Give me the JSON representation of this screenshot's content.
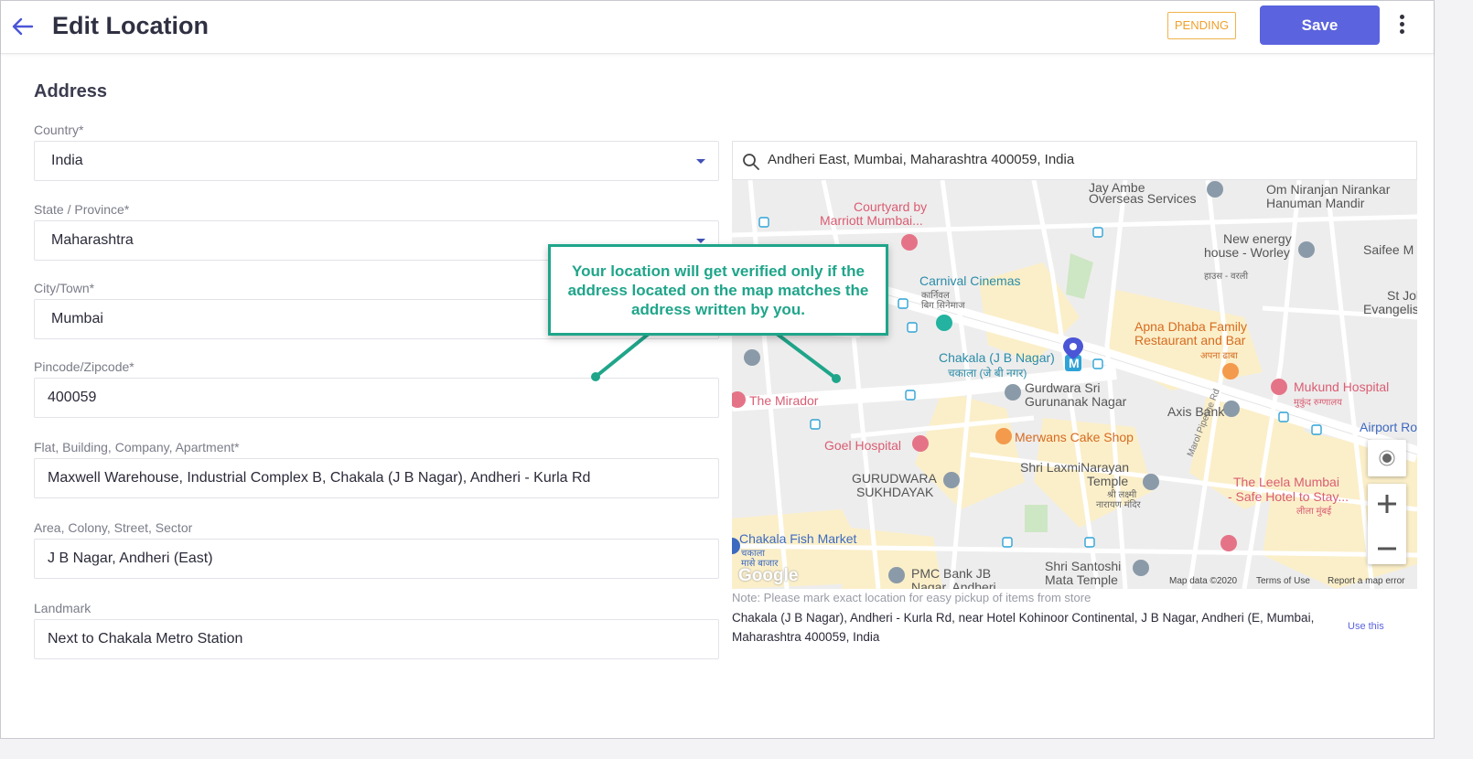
{
  "header": {
    "title": "Edit Location",
    "status": "PENDING",
    "save_label": "Save"
  },
  "form": {
    "section_title": "Address",
    "country": {
      "label": "Country*",
      "value": "India"
    },
    "state": {
      "label": "State / Province*",
      "value": "Maharashtra"
    },
    "city": {
      "label": "City/Town*",
      "value": "Mumbai"
    },
    "pincode": {
      "label": "Pincode/Zipcode*",
      "value": "400059"
    },
    "flat": {
      "label": "Flat, Building, Company, Apartment*",
      "value": "Maxwell Warehouse, Industrial Complex B, Chakala (J B Nagar), Andheri - Kurla Rd"
    },
    "area": {
      "label": "Area, Colony, Street, Sector",
      "value": "J B Nagar, Andheri (East)"
    },
    "landmark": {
      "label": "Landmark",
      "value": "Next to Chakala Metro Station"
    }
  },
  "map": {
    "search_value": "Andheri East, Mumbai, Maharashtra 400059, India",
    "labels": {
      "jay_ambe": "Jay Ambe",
      "overseas": "Overseas Services",
      "om_niranjan": "Om Niranjan Nirankar",
      "hanuman": "Hanuman Mandir",
      "courtyard": "Courtyard by",
      "marriott": "Marriott Mumbai...",
      "new_energy": "New energy",
      "worley": "house - Worley",
      "worley_hi": "हाउस - वरली",
      "saifee": "Saifee M",
      "carnival": "Carnival Cinemas",
      "carnival_mr": "कार्निवल",
      "carnival_hi": "बिग सिनेमाज",
      "st_john": "St Johi",
      "evangelist": "Evangelist Ch",
      "apna_dhaba": "Apna Dhaba Family",
      "restaurant_bar": "Restaurant and Bar",
      "apna_hi": "अपना ढाबा",
      "chakala": "Chakala (J B Nagar)",
      "chakala_mr": "चकाला (जे बी नगर)",
      "mirador": "The Mirador",
      "gurdwara": "Gurdwara Sri",
      "gurunanak": "Gurunanak Nagar",
      "axis": "Axis Bank",
      "mukund": "Mukund Hospital",
      "mukund_mr": "मुकुंद रुग्णालय",
      "goel": "Goel Hospital",
      "merwans": "Merwans Cake Shop",
      "airport": "Airport Ro",
      "laxmi": "Shri LaxmiNarayan",
      "temple": "Temple",
      "laxmi_hi": "श्री लक्ष्मी",
      "narayan_hi": "नारायण मंदिर",
      "gurudwara": "GURUDWARA",
      "sukhdayak": "SUKHDAYAK",
      "leela": "The Leela Mumbai",
      "leela2": "- Safe Hotel to Stay...",
      "leela_hi": "लीला मुंबई",
      "marol": "Marol Pipeline Rd",
      "chakala_fish": "Chakala Fish Market",
      "chakala_fish_mr": "चकाला",
      "fish_mr": "मासे बाजार",
      "pmc": "PMC Bank JB",
      "pmc2": "Nagar, Andheri",
      "santoshi": "Shri Santoshi",
      "mata": "Mata Temple",
      "google": "Google",
      "map_data": "Map data ©2020",
      "terms": "Terms of Use",
      "report": "Report a map error"
    },
    "note": "Note: Please mark exact location for easy pickup of items from store",
    "resolved_address": "Chakala (J B Nagar), Andheri - Kurla Rd, near Hotel Kohinoor Continental, J B Nagar, Andheri (E, Mumbai, Maharashtra 400059, India",
    "use_this": "Use this"
  },
  "callout": {
    "text": "Your location will get verified only if the address located on the map matches the address written by you."
  },
  "colors": {
    "accent": "#5b63de",
    "pending": "#f0a12e",
    "callout": "#1fa58a"
  },
  "icons": [
    "back-arrow-icon",
    "more-vert-icon",
    "search-icon",
    "caret-down-icon",
    "map-pin-icon",
    "my-location-icon",
    "zoom-in-icon",
    "zoom-out-icon"
  ]
}
